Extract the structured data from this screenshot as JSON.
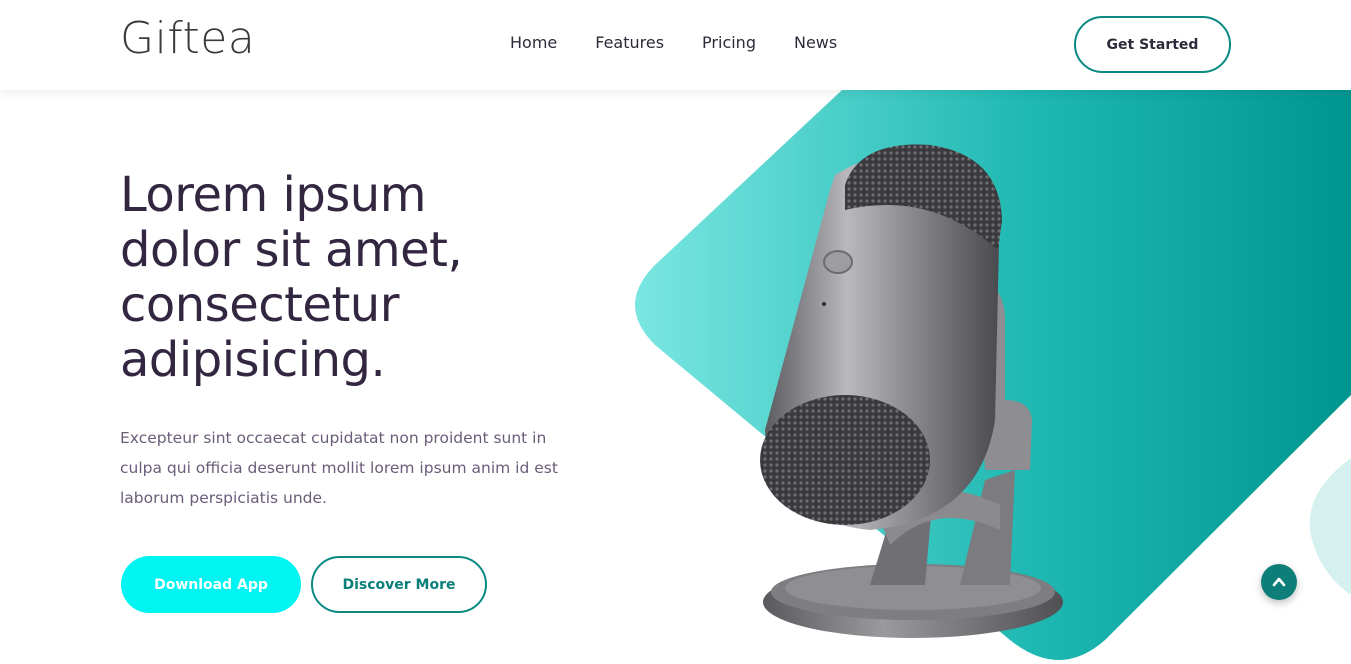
{
  "header": {
    "logo": "Giftea",
    "nav": [
      "Home",
      "Features",
      "Pricing",
      "News"
    ],
    "cta_label": "Get Started"
  },
  "hero": {
    "title": "Lorem ipsum dolor sit amet, consectetur adipisicing.",
    "text": "Excepteur sint occaecat cupidatat non proident sunt in culpa qui officia deserunt mollit lorem ipsum anim id est laborum perspiciatis unde.",
    "primary_button": "Download App",
    "secondary_button": "Discover More",
    "image": "microphone-image"
  },
  "icons": {
    "scroll_top": "chevron-up-icon"
  },
  "colors": {
    "accent": "#0a8a83",
    "primary_button": "#00f5f2",
    "heading": "#332640",
    "body_text": "#6b5d7a",
    "gradient_light": "#6fe3df",
    "gradient_dark": "#009690"
  }
}
